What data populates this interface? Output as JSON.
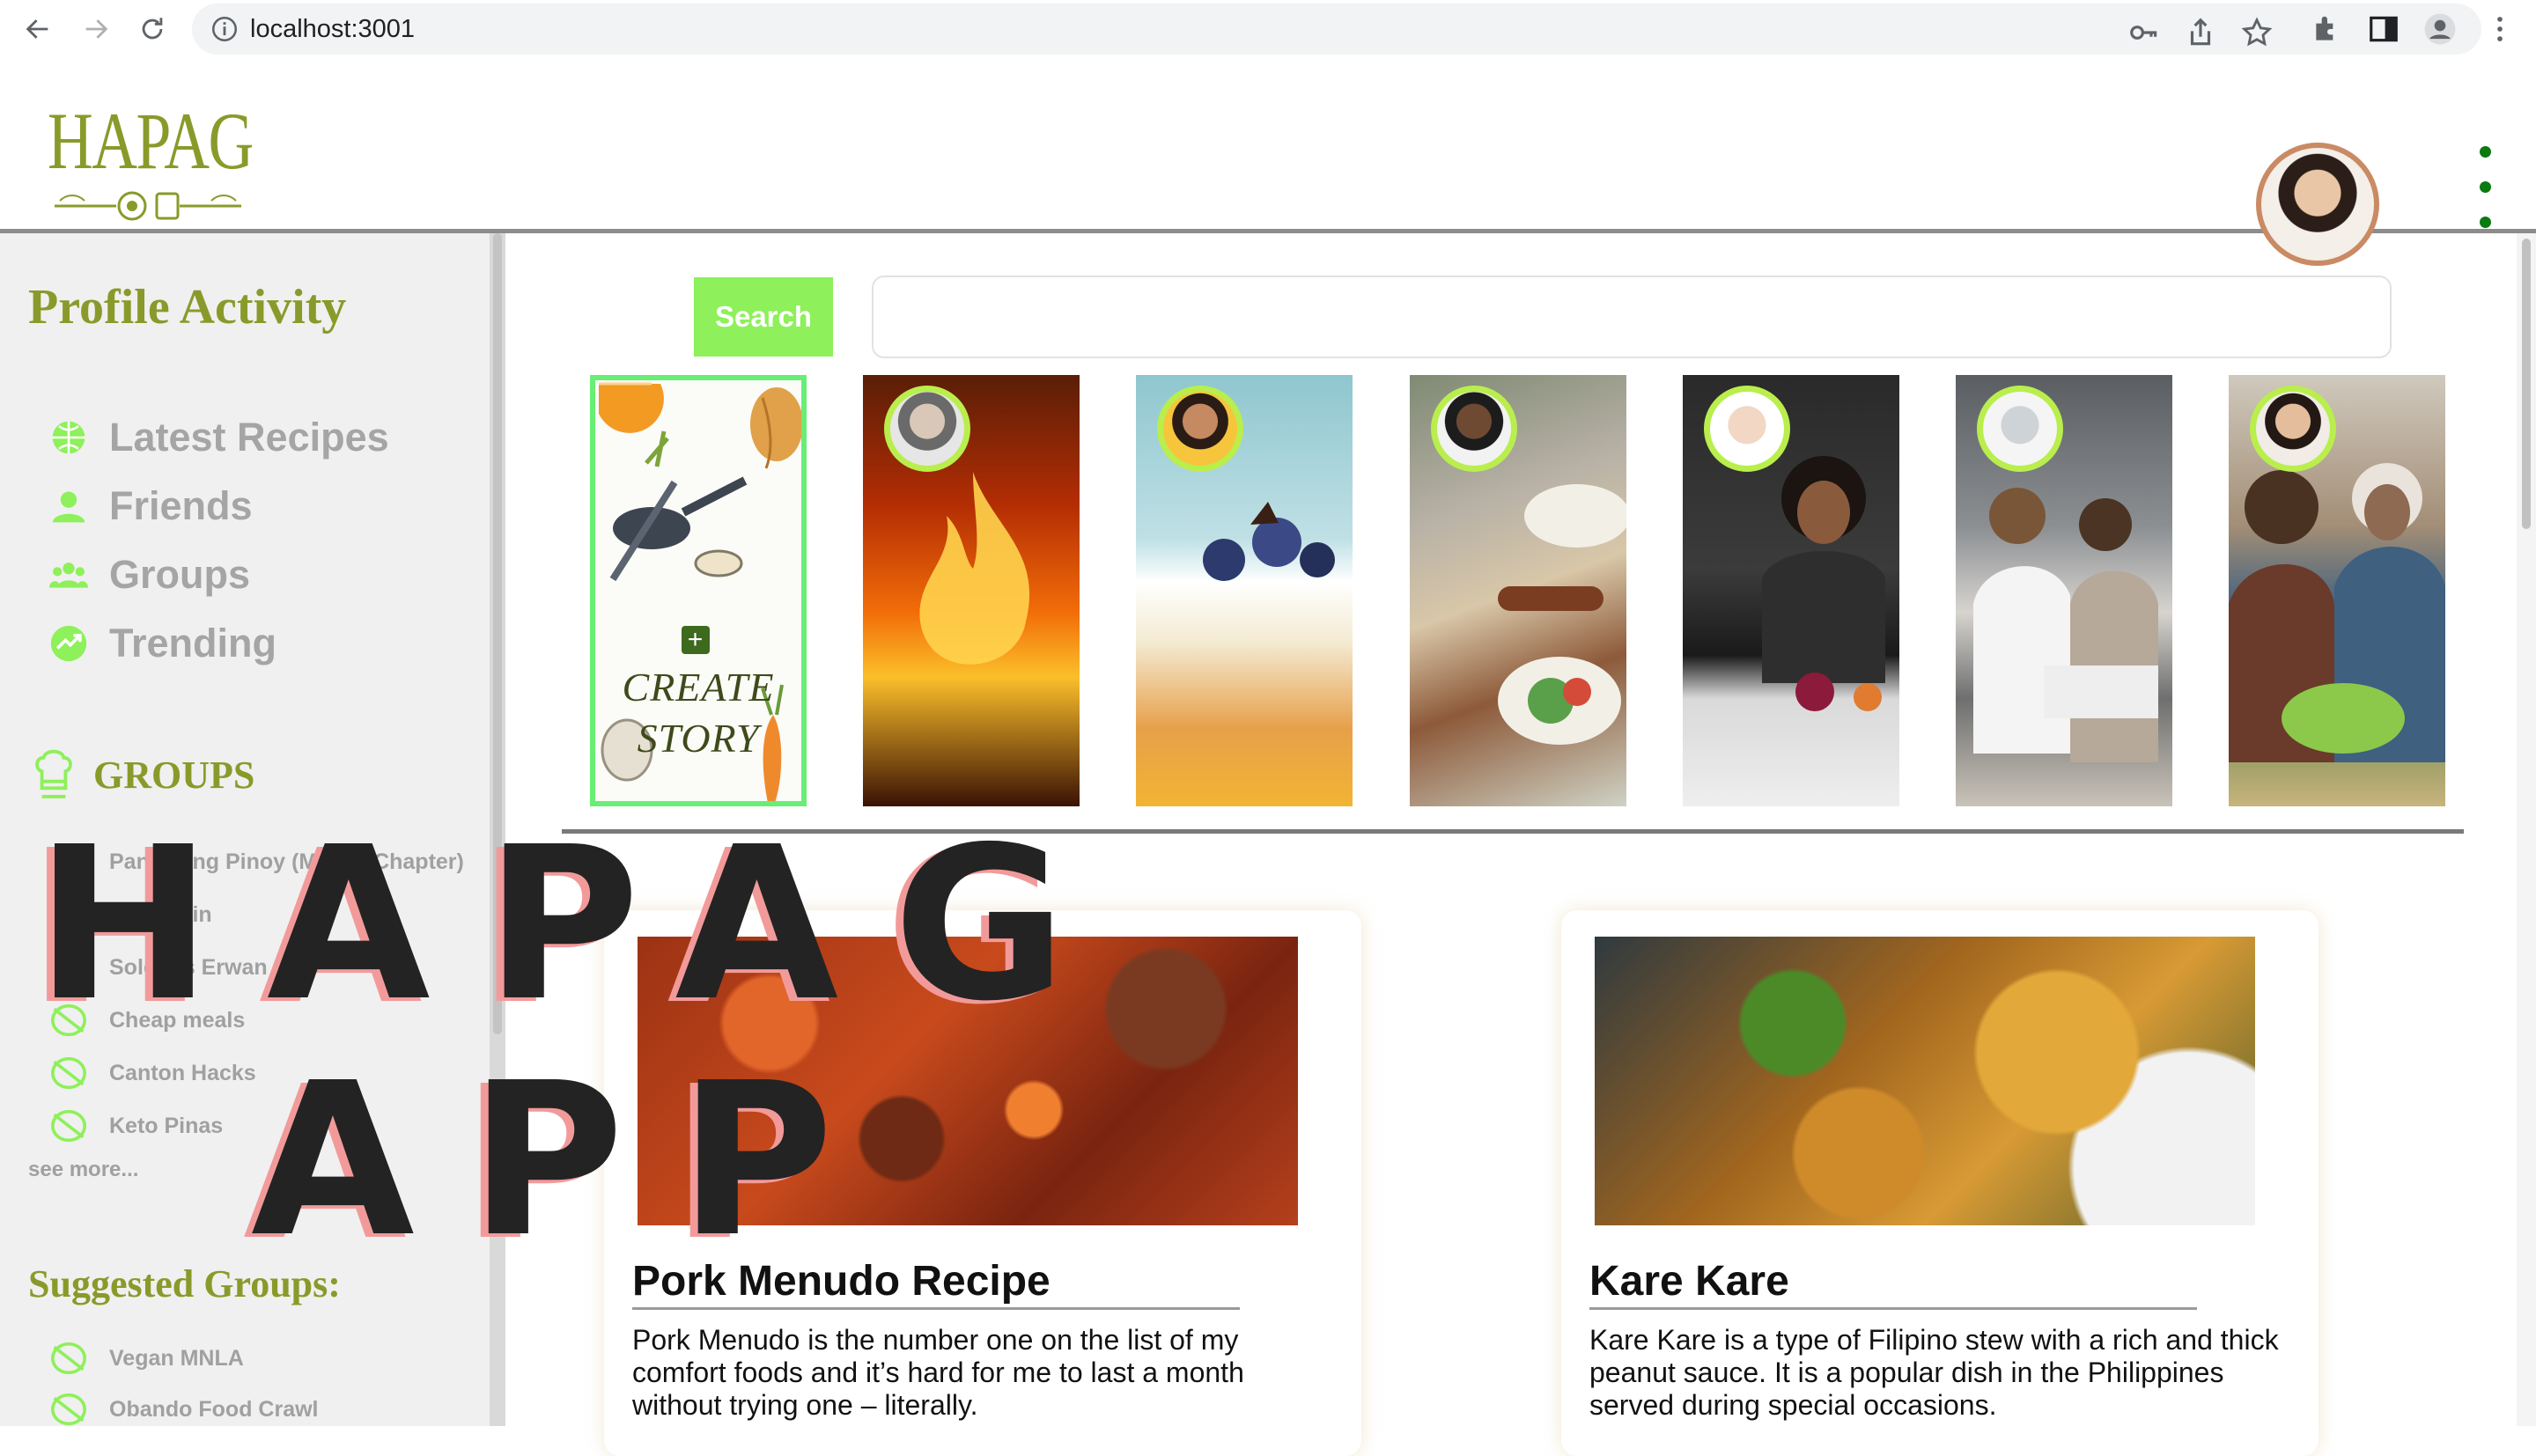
{
  "browser": {
    "url": "localhost:3001"
  },
  "app": {
    "logo_text": "HAPAG"
  },
  "sidebar": {
    "title": "Profile Activity",
    "nav": [
      {
        "label": "Latest Recipes",
        "icon": "globe-icon"
      },
      {
        "label": "Friends",
        "icon": "person-icon"
      },
      {
        "label": "Groups",
        "icon": "people-icon"
      },
      {
        "label": "Trending",
        "icon": "trending-icon"
      }
    ],
    "groups_title": "GROUPS",
    "groups": [
      {
        "label": "Panlasang Pinoy (Manila Chapter)"
      },
      {
        "label": "Chef Kain"
      },
      {
        "label": "Solero's Erwan"
      },
      {
        "label": "Cheap meals"
      },
      {
        "label": "Canton Hacks"
      },
      {
        "label": "Keto Pinas"
      }
    ],
    "see_more": "see more...",
    "suggested_title": "Suggested Groups:",
    "suggested": [
      {
        "label": "Vegan MNLA"
      },
      {
        "label": "Obando Food Crawl"
      }
    ]
  },
  "search": {
    "button_label": "Search",
    "placeholder": ""
  },
  "stories": {
    "create_label_1": "CREATE",
    "create_label_2": "STORY"
  },
  "cards": [
    {
      "title": "Pork Menudo Recipe",
      "description": "Pork Menudo is the number one on the list of my comfort foods and it’s hard for me to last a month without trying one – literally."
    },
    {
      "title": "Kare Kare",
      "description": "Kare Kare is a type of Filipino stew with a rich and thick peanut sauce. It is a popular dish in the Philippines served during special occasions."
    }
  ],
  "overlay": {
    "line1": "HAPAG",
    "line2": "APP"
  },
  "colors": {
    "brand_olive": "#8a9a2a",
    "accent_green": "#8ef05a",
    "story_ring": "#b9ee4d",
    "create_story_border": "#68ee75"
  }
}
